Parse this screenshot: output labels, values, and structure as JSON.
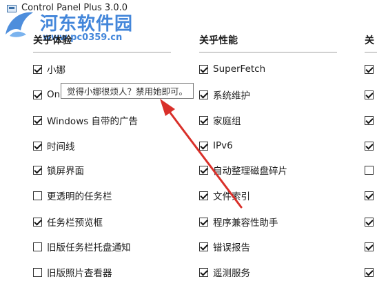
{
  "window": {
    "title": "Control Panel Plus 3.0.0"
  },
  "watermark": {
    "title": "河东软件园",
    "url": "www.pc0359.cn"
  },
  "columns": [
    {
      "header": "关乎体验",
      "items": [
        {
          "label": "小娜",
          "checked": true
        },
        {
          "label": "One",
          "checked": true
        },
        {
          "label": "Windows 自带的广告",
          "checked": true
        },
        {
          "label": "时间线",
          "checked": true
        },
        {
          "label": "锁屏界面",
          "checked": true
        },
        {
          "label": "更透明的任务栏",
          "checked": false
        },
        {
          "label": "任务栏预览框",
          "checked": true
        },
        {
          "label": "旧版任务栏托盘通知",
          "checked": false
        },
        {
          "label": "旧版照片查看器",
          "checked": false
        }
      ]
    },
    {
      "header": "关乎性能",
      "items": [
        {
          "label": "SuperFetch",
          "checked": true
        },
        {
          "label": "系统维护",
          "checked": true
        },
        {
          "label": "家庭组",
          "checked": true
        },
        {
          "label": "IPv6",
          "checked": true
        },
        {
          "label": "自动整理磁盘碎片",
          "checked": true
        },
        {
          "label": "文件索引",
          "checked": true
        },
        {
          "label": "程序兼容性助手",
          "checked": true
        },
        {
          "label": "错误报告",
          "checked": true
        },
        {
          "label": "遥测服务",
          "checked": true
        }
      ]
    },
    {
      "header": "关",
      "items": [
        {
          "label": "",
          "checked": true
        },
        {
          "label": "",
          "checked": true
        },
        {
          "label": "",
          "checked": true
        },
        {
          "label": "",
          "checked": true
        },
        {
          "label": "",
          "checked": false
        },
        {
          "label": "",
          "checked": true
        },
        {
          "label": "",
          "checked": true
        },
        {
          "label": "",
          "checked": true
        },
        {
          "label": "",
          "checked": true
        }
      ]
    }
  ],
  "tooltip": {
    "text": "觉得小娜很烦人？禁用她即可。"
  },
  "colors": {
    "watermark": "#2f7ad6",
    "annotation_arrow": "#d9302a"
  }
}
